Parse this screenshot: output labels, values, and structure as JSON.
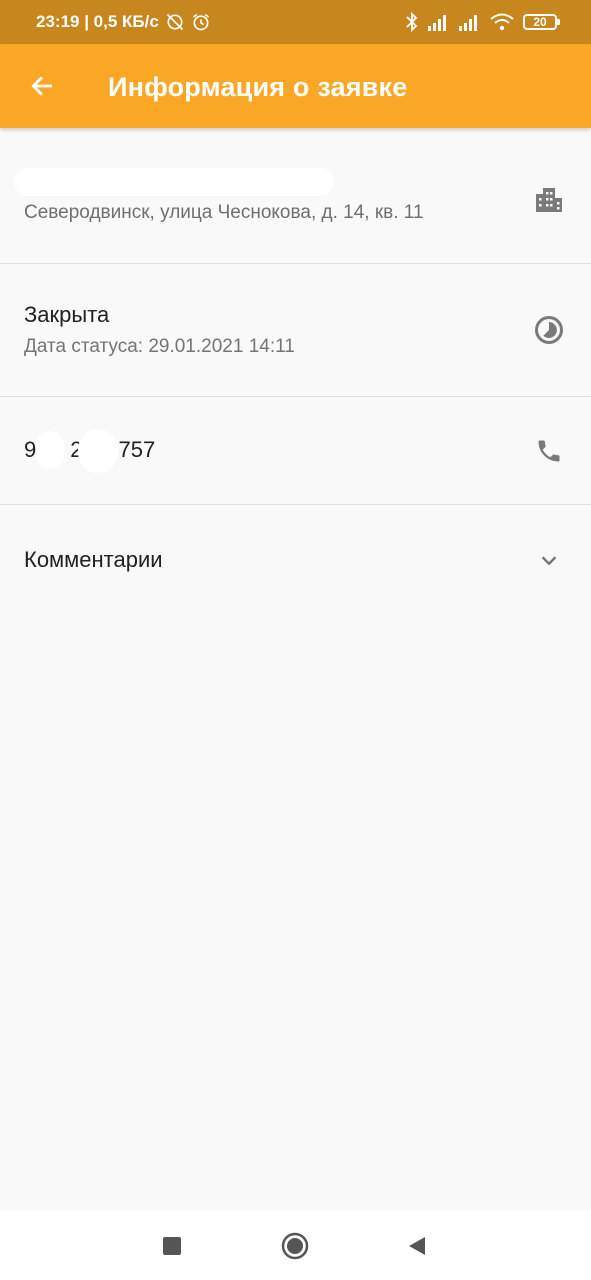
{
  "status_bar": {
    "time_speed": "23:19 | 0,5 КБ/с",
    "battery": "20"
  },
  "app_bar": {
    "title": "Информация о заявке",
    "back_icon": "arrow-left-icon",
    "background": "#fba726"
  },
  "address": {
    "line": "Северодвинск, улица Чеснокова, д. 14, кв. 11",
    "icon": "city-icon"
  },
  "status": {
    "value": "Закрыта",
    "date": "Дата статуса: 29.01.2021 14:11",
    "icon": "clock-icon"
  },
  "phone": {
    "digit_a": "9",
    "digit_b": "2",
    "digit_c": "757",
    "icon": "phone-icon"
  },
  "comments": {
    "label": "Комментарии",
    "icon": "chevron-down-icon"
  },
  "nav": {
    "recents_icon": "square-icon",
    "home_icon": "circle-icon",
    "back_icon": "triangle-back-icon"
  }
}
